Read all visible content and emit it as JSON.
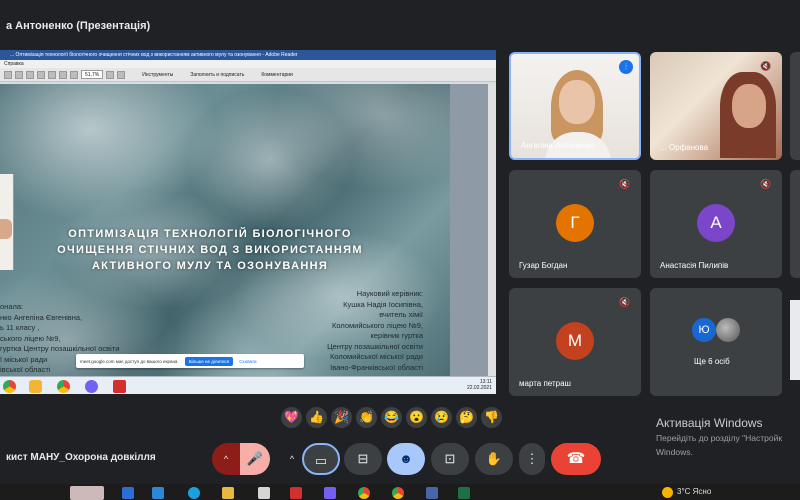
{
  "window": {
    "title": "а Антоненко (Презентація)"
  },
  "presentation": {
    "app_title": "... Оптимізація технології біологічного очищення стічних вод з використанням активного мулу та озонування - Adobe Reader",
    "menu": "Справка",
    "toolbar": {
      "zoom": "51,7%",
      "tools": "Инструменты",
      "sign": "Заполнить и подписать",
      "comment": "Комментарии"
    },
    "slide": {
      "title_lines": [
        "ОПТИМІЗАЦІЯ  ТЕХНОЛОГІЙ БІОЛОГІЧНОГО",
        "ОЧИЩЕННЯ СТІЧНИХ ВОД З ВИКОРИСТАННЯМ",
        "АКТИВНОГО МУЛУ ТА ОЗОНУВАННЯ"
      ],
      "left_lines": [
        "онала:",
        "нко Ангеліна Євгенівна,",
        "ь 11 класу ,",
        "ського ліцею №9,",
        "гуртка Центру позашкільної освіти",
        "ї міської ради",
        "івської області"
      ],
      "right_lines": [
        "Науковий керівник:",
        "Кушка Надія Іосипівна,",
        "вчитель хімії",
        "Коломийського ліцею №9,",
        "керівник гуртка",
        "Центру позашкільної освіти",
        "Коломийської міської ради",
        "Івано-Франківської області"
      ]
    },
    "share_banner": {
      "text": "meet.google.com має доступ до вашого екрана.",
      "stop": "Більше не ділитися",
      "hide": "Сховати"
    },
    "tray": {
      "time": "13:11",
      "date": "22.02.2021"
    }
  },
  "participants": [
    {
      "name": "Ангеліна Антоненко",
      "type": "video",
      "speaking": true
    },
    {
      "name": "... Орфанова",
      "type": "video"
    },
    {
      "name": "Гузар Богдан",
      "initial": "Г",
      "color": "#e37400"
    },
    {
      "name": "Анастасія Пилипів",
      "initial": "А",
      "color": "#7b46c9"
    },
    {
      "name": "марта петраш",
      "initial": "М",
      "color": "#c4411f"
    },
    {
      "name": "Ще 6 осіб",
      "initial": "Ю",
      "color": "#1967d2"
    }
  ],
  "reactions": [
    "💖",
    "👍",
    "🎉",
    "👏",
    "😂",
    "😮",
    "😢",
    "🤔",
    "👎"
  ],
  "controls": {
    "meeting_name": "кист МАНУ_Охорона довкілля",
    "icons": [
      "chevron-up-icon",
      "mic-off-icon",
      "chevron-up-icon",
      "camera-icon",
      "captions-icon",
      "emoji-icon",
      "present-icon",
      "raise-hand-icon",
      "more-icon",
      "end-call-icon"
    ]
  },
  "windows_activation": {
    "heading": "Активація Windows",
    "sub1": "Перейдіть до розділу \"Настройк",
    "sub2": "Windows."
  },
  "os_tray": {
    "temp": "3°C Ясно"
  }
}
